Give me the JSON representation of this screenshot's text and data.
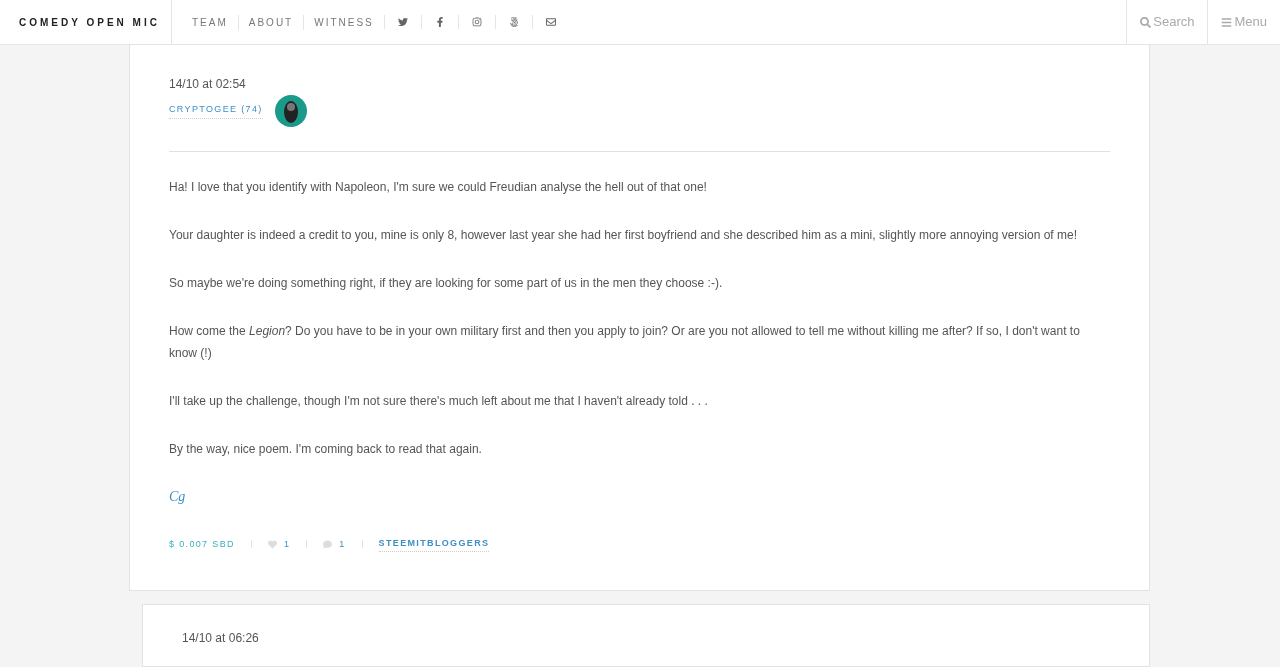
{
  "brand": "COMEDY OPEN MIC",
  "nav": [
    {
      "kind": "link",
      "label": "TEAM"
    },
    {
      "kind": "link",
      "label": "ABOUT"
    },
    {
      "kind": "link",
      "label": "WITNESS"
    },
    {
      "kind": "twitter"
    },
    {
      "kind": "facebook"
    },
    {
      "kind": "instagram"
    },
    {
      "kind": "photos"
    },
    {
      "kind": "mail"
    }
  ],
  "search": "Search",
  "menu": "Menu",
  "comment": {
    "date": "14/10 at 02:54",
    "author": "CRYPTOGEE (74)",
    "paragraphs": [
      "Ha! I love that you identify with Napoleon, I'm sure we could Freudian analyse the hell out of that one!",
      "Your daughter is indeed a credit to you, mine is only 8, however last year she had her first boyfriend and she described him as a mini, slightly more annoying version of me!",
      "So maybe we're doing something right, if they are looking for some part of us in the men they choose :-).",
      "How come the *Legion*? Do you have to be in your own military first and then you apply to join? Or are you not allowed to tell me without killing me after? If so, I don't want to know (!)",
      "I'll take up the challenge, though I'm not sure there's much left about me that I haven't already told . . .",
      "By the way, nice poem. I'm coming back to read that again."
    ],
    "signature": "Cg",
    "payout": "$ 0.007 SBD",
    "votes": "1",
    "replies": "1",
    "tag": "STEEMITBLOGGERS"
  },
  "next_comment": {
    "date": "14/10 at 06:26"
  }
}
